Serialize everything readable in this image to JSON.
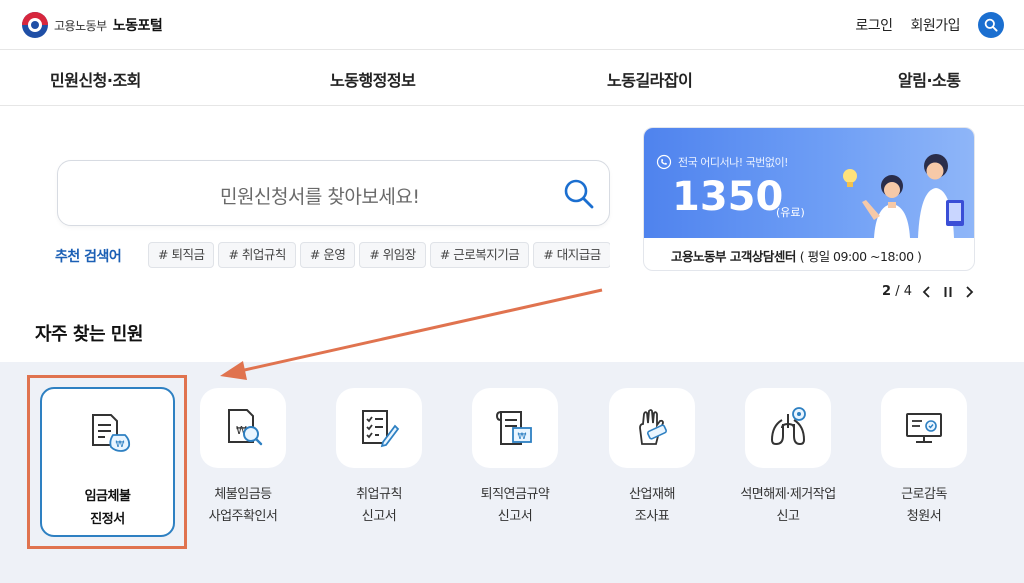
{
  "header": {
    "ministry_name": "고용노동부",
    "portal_name": "노동포털",
    "login": "로그인",
    "signup": "회원가입",
    "search_icon": "search-icon"
  },
  "nav": {
    "items": [
      {
        "label": "민원신청·조회"
      },
      {
        "label": "노동행정정보"
      },
      {
        "label": "노동길라잡이"
      },
      {
        "label": "알림·소통"
      }
    ]
  },
  "search": {
    "placeholder": "민원신청서를 찾아보세요!",
    "recommended_label": "추천 검색어",
    "tags": [
      "# 퇴직금",
      "# 취업규칙",
      "# 운영",
      "# 위임장",
      "# 근로복지기금",
      "# 대지급금"
    ]
  },
  "banner": {
    "subtitle": "전국 어디서나! 국번없이!",
    "number": "1350",
    "paid_note": "(유료)",
    "center_name": "고용노동부 고객상담센터",
    "hours": "( 평일 09:00 ~18:00 )",
    "accent_color": "#4f83ee"
  },
  "pager": {
    "current": "2",
    "separator": "/",
    "total": "4"
  },
  "frequent": {
    "title": "자주 찾는 민원",
    "items": [
      {
        "line1": "임금체불",
        "line2": "진정서",
        "icon": "wage-claim-icon",
        "selected": true
      },
      {
        "line1": "체불임금등",
        "line2": "사업주확인서",
        "icon": "document-search-icon"
      },
      {
        "line1": "취업규칙",
        "line2": "신고서",
        "icon": "checklist-icon"
      },
      {
        "line1": "퇴직연금규약",
        "line2": "신고서",
        "icon": "pension-doc-icon"
      },
      {
        "line1": "산업재해",
        "line2": "조사표",
        "icon": "injured-hand-icon"
      },
      {
        "line1": "석면해제·제거작업",
        "line2": "신고",
        "icon": "lungs-icon"
      },
      {
        "line1": "근로감독",
        "line2": "청원서",
        "icon": "monitor-icon"
      }
    ]
  },
  "colors": {
    "selected_border": "#2e80c2",
    "annotation": "#e0734f",
    "band_bg": "#eef1f7"
  }
}
